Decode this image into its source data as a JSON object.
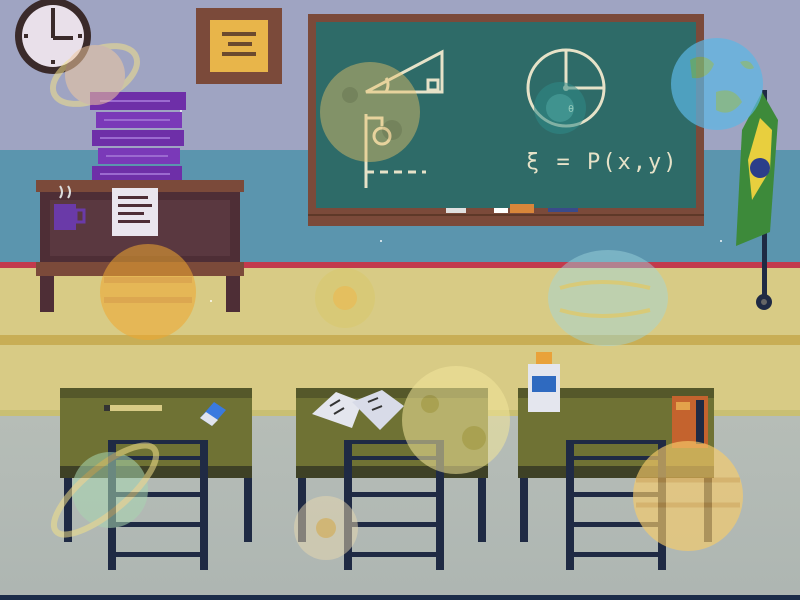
{
  "scene": {
    "blackboard": {
      "formula": "ξ = P(x,y)",
      "angle_symbol": "θ"
    },
    "decorations": {
      "clock": "wall-clock",
      "frame": "framed-picture",
      "flag": "brazil-flag",
      "planets": [
        "earth-icon",
        "jupiter-icon",
        "saturn-icon",
        "venus-icon",
        "moon-icon",
        "saturn-icon",
        "sun-icon"
      ]
    },
    "objects": [
      "books-stack",
      "coffee-mug",
      "paper-note",
      "pencil",
      "eraser",
      "open-book",
      "glue-bottle",
      "calculator"
    ]
  },
  "colors": {
    "wall": "#9fa4c2",
    "window_band": "#5b95ae",
    "board": "#2e6b68",
    "wood": "#7b4a3a",
    "desk": "#6f7234",
    "metal": "#1f2a44",
    "floor": "#d8cb85",
    "chalk": "#e6e2c8"
  }
}
